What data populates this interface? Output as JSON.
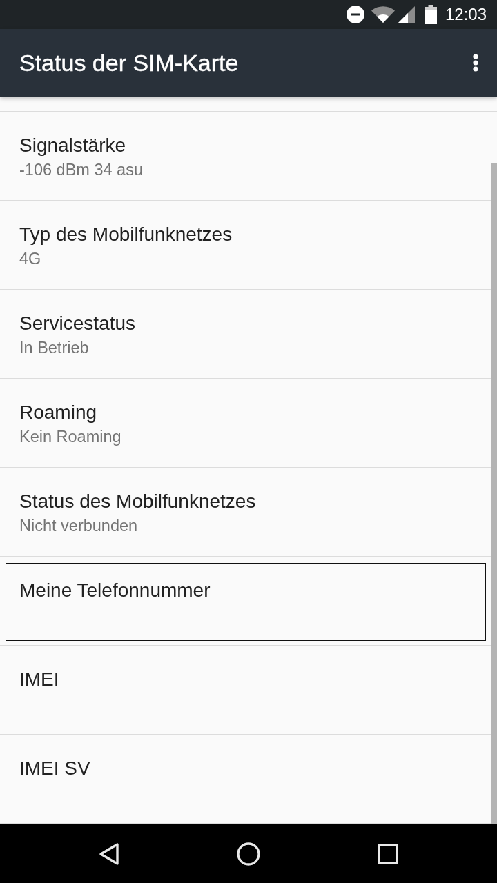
{
  "status_bar": {
    "time": "12:03"
  },
  "app_bar": {
    "title": "Status der SIM-Karte"
  },
  "items": [
    {
      "title": "Signalstärke",
      "summary": "-106 dBm 34 asu",
      "selected": false
    },
    {
      "title": "Typ des Mobilfunknetzes",
      "summary": "4G",
      "selected": false
    },
    {
      "title": "Servicestatus",
      "summary": "In Betrieb",
      "selected": false
    },
    {
      "title": "Roaming",
      "summary": "Kein Roaming",
      "selected": false
    },
    {
      "title": "Status des Mobilfunknetzes",
      "summary": "Nicht verbunden",
      "selected": false
    },
    {
      "title": "Meine Telefonnummer",
      "selected": true
    },
    {
      "title": "IMEI",
      "selected": false
    },
    {
      "title": "IMEI SV",
      "selected": false
    }
  ]
}
